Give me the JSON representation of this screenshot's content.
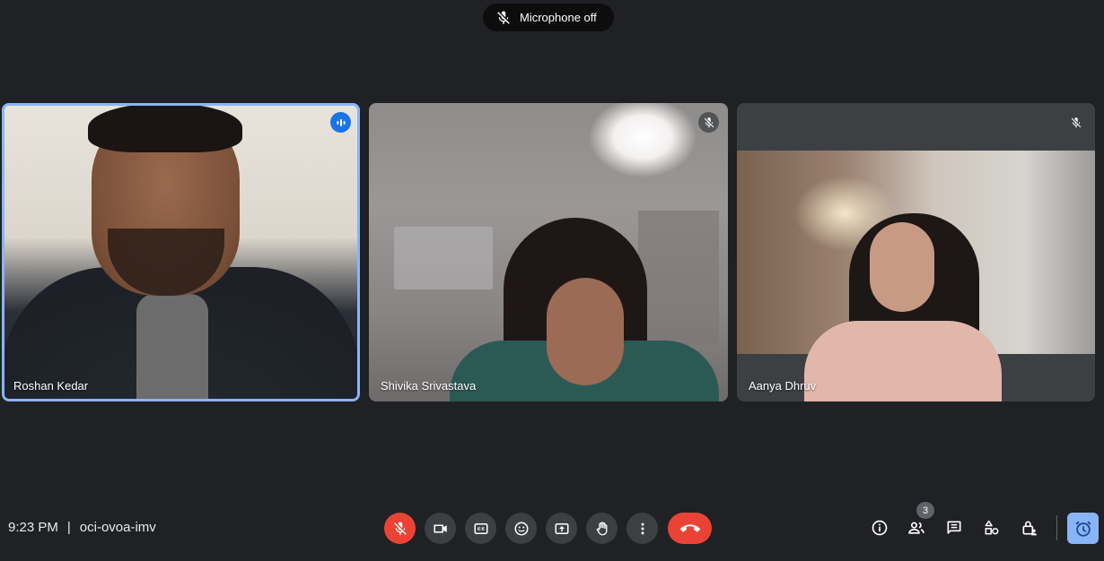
{
  "toast": {
    "text": "Microphone off",
    "icon": "mic-off-icon"
  },
  "participants": [
    {
      "name": "Roshan Kedar",
      "status_icon": "speaking-icon",
      "active_speaker": true
    },
    {
      "name": "Shivika Srivastava",
      "status_icon": "mic-off-icon",
      "active_speaker": false
    },
    {
      "name": "Aanya Dhruv",
      "status_icon": "mic-off-icon",
      "active_speaker": false
    }
  ],
  "footer": {
    "time": "9:23 PM",
    "separator": "|",
    "meeting_code": "oci-ovoa-imv"
  },
  "controls": [
    {
      "name": "microphone",
      "icon": "mic-off-icon",
      "state": "off",
      "color": "#ea4335"
    },
    {
      "name": "camera",
      "icon": "videocam-icon"
    },
    {
      "name": "captions",
      "icon": "closed-caption-icon"
    },
    {
      "name": "reactions",
      "icon": "emoji-icon"
    },
    {
      "name": "present",
      "icon": "present-screen-icon"
    },
    {
      "name": "raise-hand",
      "icon": "hand-icon"
    },
    {
      "name": "more-options",
      "icon": "more-vert-icon"
    },
    {
      "name": "leave-call",
      "icon": "call-end-icon",
      "color": "#ea4335"
    }
  ],
  "side_controls": {
    "info_icon": "info-icon",
    "people_icon": "people-icon",
    "people_count": "3",
    "chat_icon": "chat-icon",
    "activities_icon": "activities-icon",
    "host_controls_icon": "lock-person-icon",
    "alarm_icon": "alarm-icon"
  },
  "colors": {
    "background": "#202124",
    "tile": "#3c4043",
    "accent": "#8ab4f8",
    "danger": "#ea4335"
  }
}
